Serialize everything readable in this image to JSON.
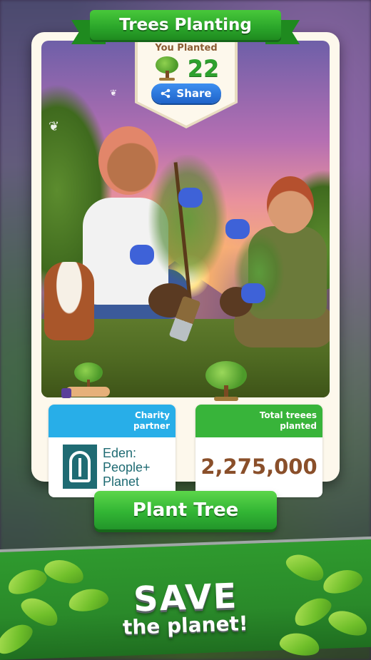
{
  "header": {
    "title": "Trees Planting"
  },
  "planted": {
    "label": "You Planted",
    "count": "22",
    "tree_icon": "tree-icon"
  },
  "share": {
    "label": "Share",
    "icon": "share-icon"
  },
  "charity": {
    "label": "Charity\npartner",
    "partner_line1": "Eden:",
    "partner_line2": "People+",
    "partner_line3": "Planet",
    "icon": "hand-tree-icon",
    "accent": "#28aee8"
  },
  "total": {
    "label": "Total treees\nplanted",
    "value": "2,275,000",
    "icon": "tree-icon",
    "accent": "#38b43a"
  },
  "action": {
    "plant_label": "Plant Tree"
  },
  "slogan": {
    "line1": "SAVE",
    "line2": "the planet!"
  },
  "colors": {
    "primary_green": "#32b534",
    "share_blue": "#1f63c9",
    "count_green": "#2ea12e",
    "value_brown": "#8a4f2a"
  }
}
